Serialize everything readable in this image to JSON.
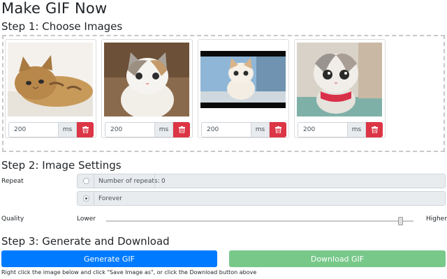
{
  "title": "Make GIF Now",
  "step1": {
    "heading": "Step 1: Choose Images",
    "images": [
      {
        "thumb": "kitten-lying",
        "duration": "200",
        "unit": "ms"
      },
      {
        "thumb": "kitten-sitting",
        "duration": "200",
        "unit": "ms"
      },
      {
        "thumb": "kitten-window",
        "duration": "200",
        "unit": "ms"
      },
      {
        "thumb": "kitten-red-harness",
        "duration": "200",
        "unit": "ms"
      }
    ]
  },
  "step2": {
    "heading": "Step 2: Image Settings",
    "repeat_label": "Repeat",
    "repeat_options": [
      {
        "label": "Number of repeats:",
        "value": "0",
        "checked": false
      },
      {
        "label": "Forever",
        "checked": true
      }
    ],
    "quality_label": "Quality",
    "quality_low": "Lower",
    "quality_high": "Higher",
    "quality_level": 0.98
  },
  "step3": {
    "heading": "Step 3: Generate and Download",
    "generate_label": "Generate GIF",
    "download_label": "Download GIF",
    "note": "Right click the image below and click \"Save Image as\", or click the Download button above"
  },
  "colors": {
    "primary": "#007bff",
    "danger": "#dc3545",
    "success_disabled": "#78c88a"
  }
}
